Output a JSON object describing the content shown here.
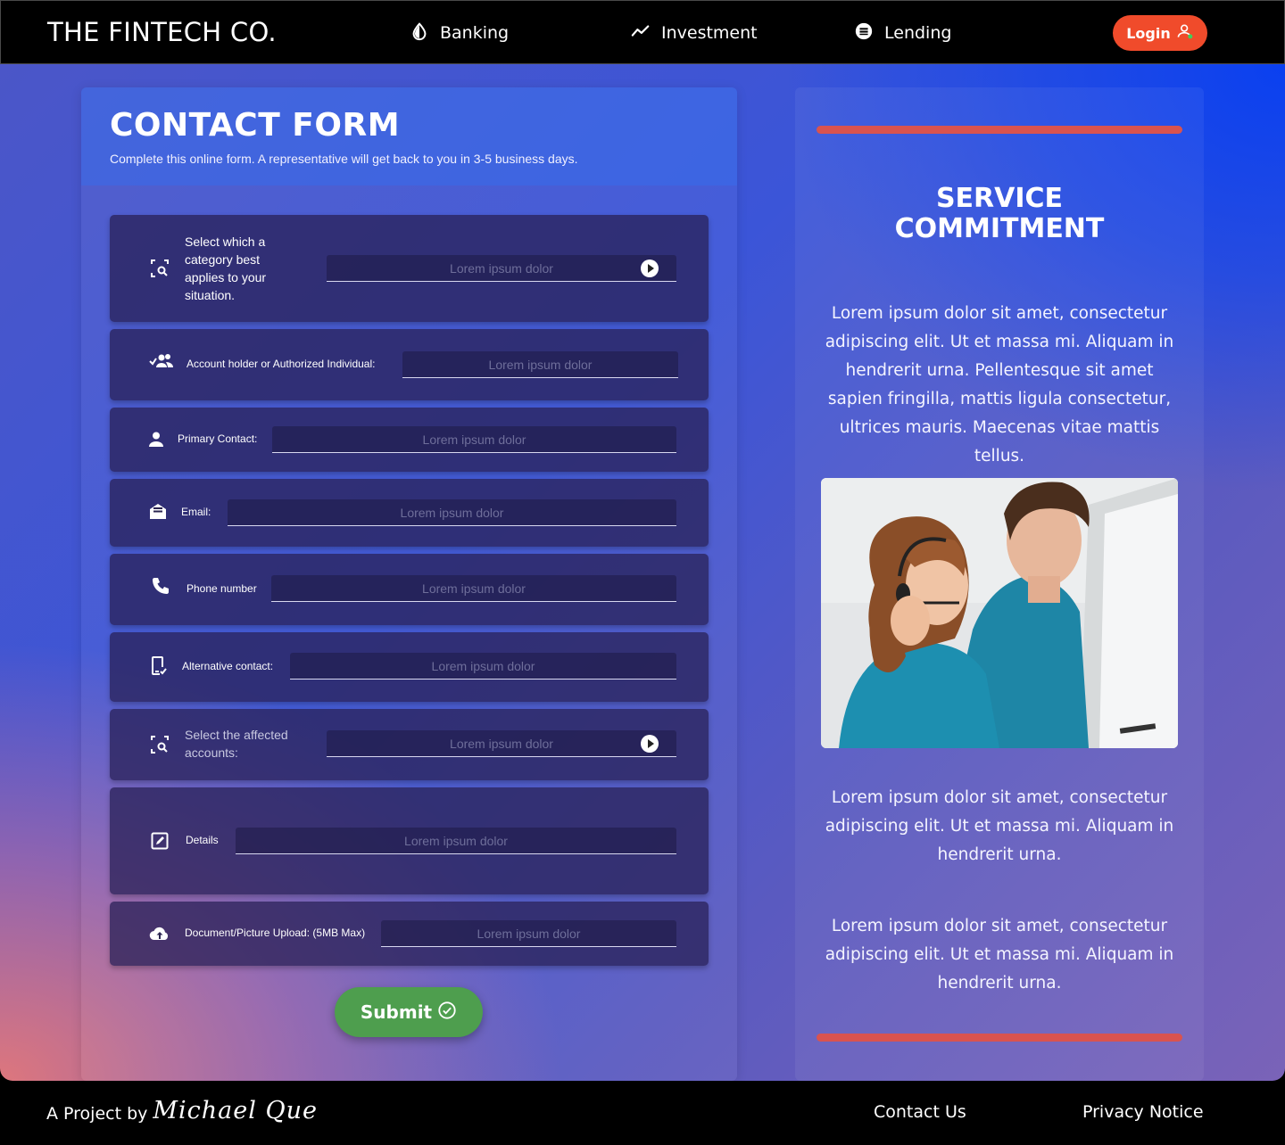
{
  "nav": {
    "brand": "THE FINTECH CO.",
    "items": [
      {
        "label": "Banking",
        "icon": "drop-icon"
      },
      {
        "label": "Investment",
        "icon": "trend-icon"
      },
      {
        "label": "Lending",
        "icon": "lending-icon"
      }
    ],
    "login_label": "Login"
  },
  "form": {
    "title": "CONTACT FORM",
    "subtitle": "Complete this online form. A representative will get back to you in 3-5 business days.",
    "rows": [
      {
        "label": "Select which a category best applies to your situation.",
        "placeholder": "Lorem ipsum dolor"
      },
      {
        "label": "Account holder or Authorized Individual:",
        "placeholder": "Lorem ipsum dolor"
      },
      {
        "label": "Primary Contact:",
        "placeholder": "Lorem ipsum dolor"
      },
      {
        "label": "Email:",
        "placeholder": "Lorem ipsum dolor"
      },
      {
        "label": "Phone number",
        "placeholder": "Lorem ipsum dolor"
      },
      {
        "label": "Alternative contact:",
        "placeholder": "Lorem ipsum dolor"
      },
      {
        "label": "Select the affected accounts:",
        "placeholder": "Lorem ipsum dolor"
      },
      {
        "label": "Details",
        "placeholder": "Lorem ipsum dolor"
      },
      {
        "label": "Document/Picture  Upload: (5MB Max)",
        "placeholder": "Lorem ipsum dolor"
      }
    ],
    "submit_label": "Submit"
  },
  "side": {
    "title_line1": "SERVICE",
    "title_line2": "COMMITMENT",
    "para1": "Lorem ipsum dolor sit amet, consectetur adipiscing elit. Ut et massa mi. Aliquam in hendrerit urna. Pellentesque sit amet sapien fringilla, mattis ligula consectetur, ultrices mauris. Maecenas vitae mattis tellus.",
    "para2": "Lorem ipsum dolor sit amet, consectetur adipiscing elit. Ut et massa mi. Aliquam in hendrerit urna.",
    "para3": "Lorem ipsum dolor sit amet, consectetur adipiscing elit. Ut et massa mi. Aliquam in hendrerit urna.",
    "accent_color": "#d9534f"
  },
  "footer": {
    "credit_prefix": "A Project by",
    "signature": "Michael Que",
    "links": [
      "Contact Us",
      "Privacy Notice"
    ]
  },
  "colors": {
    "login": "#f04b2b",
    "submit": "#4e9e4e"
  }
}
